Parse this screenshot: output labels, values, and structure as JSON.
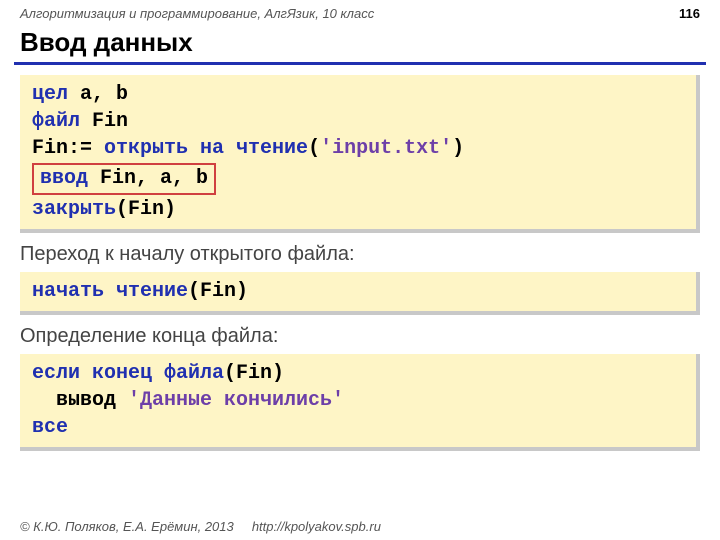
{
  "meta": {
    "course": "Алгоритмизация и программирование, АлгЯзик, 10 класс",
    "page": "116"
  },
  "title": "Ввод данных",
  "block1": {
    "l1_kw": "цел",
    "l1_rest": " a, b",
    "l2_kw": "файл",
    "l2_rest": " Fin",
    "l3_a": "Fin:= ",
    "l3_kw": "открыть на чтение",
    "l3_p1": "(",
    "l3_str": "'input.txt'",
    "l3_p2": ")",
    "l4_kw": "ввод",
    "l4_rest": " Fin, a, b",
    "l5_kw": "закрыть",
    "l5_rest": "(Fin)"
  },
  "sub1": "Переход к началу открытого файла:",
  "block2": {
    "kw": "начать чтение",
    "rest": "(Fin)"
  },
  "sub2": "Определение конца файла:",
  "block3": {
    "l1_kw": "если",
    "l1_kw2": " конец файла",
    "l1_rest": "(Fin)",
    "l2_a": "  вывод ",
    "l2_str": "'Данные кончились'",
    "l3_kw": "все"
  },
  "footer": {
    "copy": "© К.Ю. Поляков, Е.А. Ерёмин, 2013",
    "url": "http://kpolyakov.spb.ru"
  }
}
